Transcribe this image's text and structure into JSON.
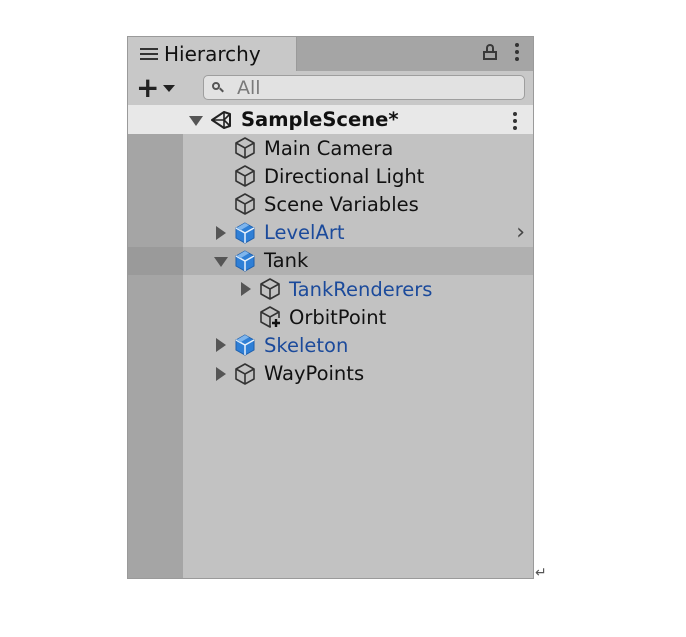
{
  "header": {
    "tab_title": "Hierarchy"
  },
  "toolbar": {
    "add_label": "+",
    "search_placeholder": "All"
  },
  "scene": {
    "name": "SampleScene*"
  },
  "items": [
    {
      "label": "Main Camera",
      "type": "gameobject",
      "expandable": false,
      "expanded": false,
      "prefab": false,
      "depth": 1
    },
    {
      "label": "Directional Light",
      "type": "gameobject",
      "expandable": false,
      "expanded": false,
      "prefab": false,
      "depth": 1
    },
    {
      "label": "Scene Variables",
      "type": "gameobject",
      "expandable": false,
      "expanded": false,
      "prefab": false,
      "depth": 1
    },
    {
      "label": "LevelArt",
      "type": "prefab",
      "expandable": true,
      "expanded": false,
      "prefab": true,
      "depth": 1,
      "has_chevron": true
    },
    {
      "label": "Tank",
      "type": "prefab",
      "expandable": true,
      "expanded": true,
      "prefab": false,
      "depth": 1,
      "selected": true
    },
    {
      "label": "TankRenderers",
      "type": "gameobject",
      "expandable": true,
      "expanded": false,
      "prefab": true,
      "depth": 2
    },
    {
      "label": "OrbitPoint",
      "type": "gameobject-added",
      "expandable": false,
      "expanded": false,
      "prefab": false,
      "depth": 2
    },
    {
      "label": "Skeleton",
      "type": "prefab",
      "expandable": true,
      "expanded": false,
      "prefab": true,
      "depth": 1
    },
    {
      "label": "WayPoints",
      "type": "gameobject",
      "expandable": true,
      "expanded": false,
      "prefab": false,
      "depth": 1
    }
  ],
  "colors": {
    "panel_bg": "#c2c2c2",
    "prefab_text": "#1b4a9b",
    "prefab_icon": "#2f7fd6",
    "selected_row": "#b0b0b0"
  },
  "icons": {
    "tab": "list-icon",
    "lock": "lock-icon",
    "menu": "kebab-menu-icon",
    "search": "search-icon",
    "scene": "unity-logo-icon",
    "gameobject": "cube-outline-icon",
    "prefab": "prefab-cube-icon",
    "added": "added-gameobject-icon"
  }
}
